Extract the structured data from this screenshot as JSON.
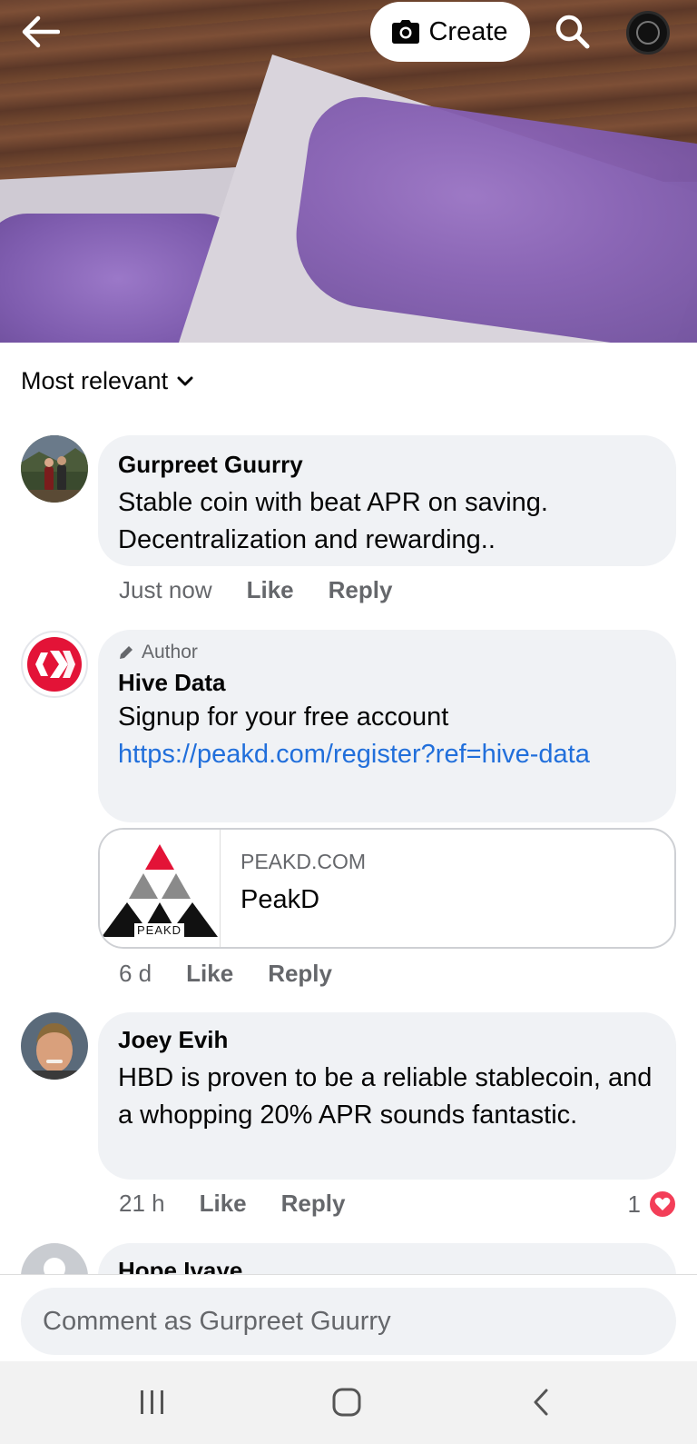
{
  "header": {
    "back_icon": "arrow-left-icon",
    "create_label": "Create",
    "camera_icon": "camera-icon",
    "search_icon": "search-icon",
    "profile_icon": "profile-avatar"
  },
  "sort": {
    "label": "Most relevant",
    "icon": "chevron-down-icon"
  },
  "comments": [
    {
      "author": "Gurpreet Guurry",
      "text": "Stable coin with beat APR on saving. Decentralization and rewarding..",
      "time": "Just now",
      "like": "Like",
      "reply": "Reply"
    },
    {
      "author_tag": "Author",
      "author": "Hive Data",
      "text": "Signup for your free account",
      "link": "https://peakd.com/register?ref=hive-data",
      "preview": {
        "domain": "PEAKD.COM",
        "title": "PeakD",
        "logo_text": "PEAKD"
      },
      "time": "6 d",
      "like": "Like",
      "reply": "Reply"
    },
    {
      "author": "Joey Evih",
      "text": "HBD is proven to be a reliable stablecoin, and a whopping 20% APR sounds fantastic.",
      "time": "21 h",
      "like": "Like",
      "reply": "Reply",
      "reaction_count": "1"
    },
    {
      "author": "Hope Ivaye"
    }
  ],
  "composer": {
    "placeholder": "Comment as Gurpreet Guurry"
  },
  "colors": {
    "link": "#216fdb",
    "heart": "#f33e58",
    "bubble": "#f0f2f5",
    "hive_red": "#e31337"
  }
}
